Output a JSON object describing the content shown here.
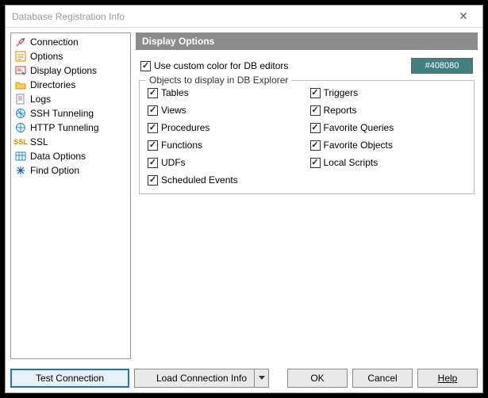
{
  "window": {
    "title": "Database Registration Info"
  },
  "sidebar": {
    "items": [
      {
        "label": "Connection"
      },
      {
        "label": "Options"
      },
      {
        "label": "Display Options"
      },
      {
        "label": "Directories"
      },
      {
        "label": "Logs"
      },
      {
        "label": "SSH Tunneling"
      },
      {
        "label": "HTTP Tunneling"
      },
      {
        "label": "SSL"
      },
      {
        "label": "Data Options"
      },
      {
        "label": "Find Option"
      }
    ]
  },
  "main": {
    "header": "Display Options",
    "useCustomColor": "Use custom color for DB editors",
    "colorHex": "#408080",
    "fieldsetLegend": "Objects to display in DB Explorer",
    "objects": {
      "left": [
        {
          "label": "Tables"
        },
        {
          "label": "Views"
        },
        {
          "label": "Procedures"
        },
        {
          "label": "Functions"
        },
        {
          "label": "UDFs"
        },
        {
          "label": "Scheduled Events"
        }
      ],
      "right": [
        {
          "label": "Triggers"
        },
        {
          "label": "Reports"
        },
        {
          "label": "Favorite Queries"
        },
        {
          "label": "Favorite Objects"
        },
        {
          "label": "Local Scripts"
        }
      ]
    }
  },
  "buttons": {
    "test": "Test Connection",
    "load": "Load Connection Info",
    "ok": "OK",
    "cancel": "Cancel",
    "help": "Help"
  }
}
